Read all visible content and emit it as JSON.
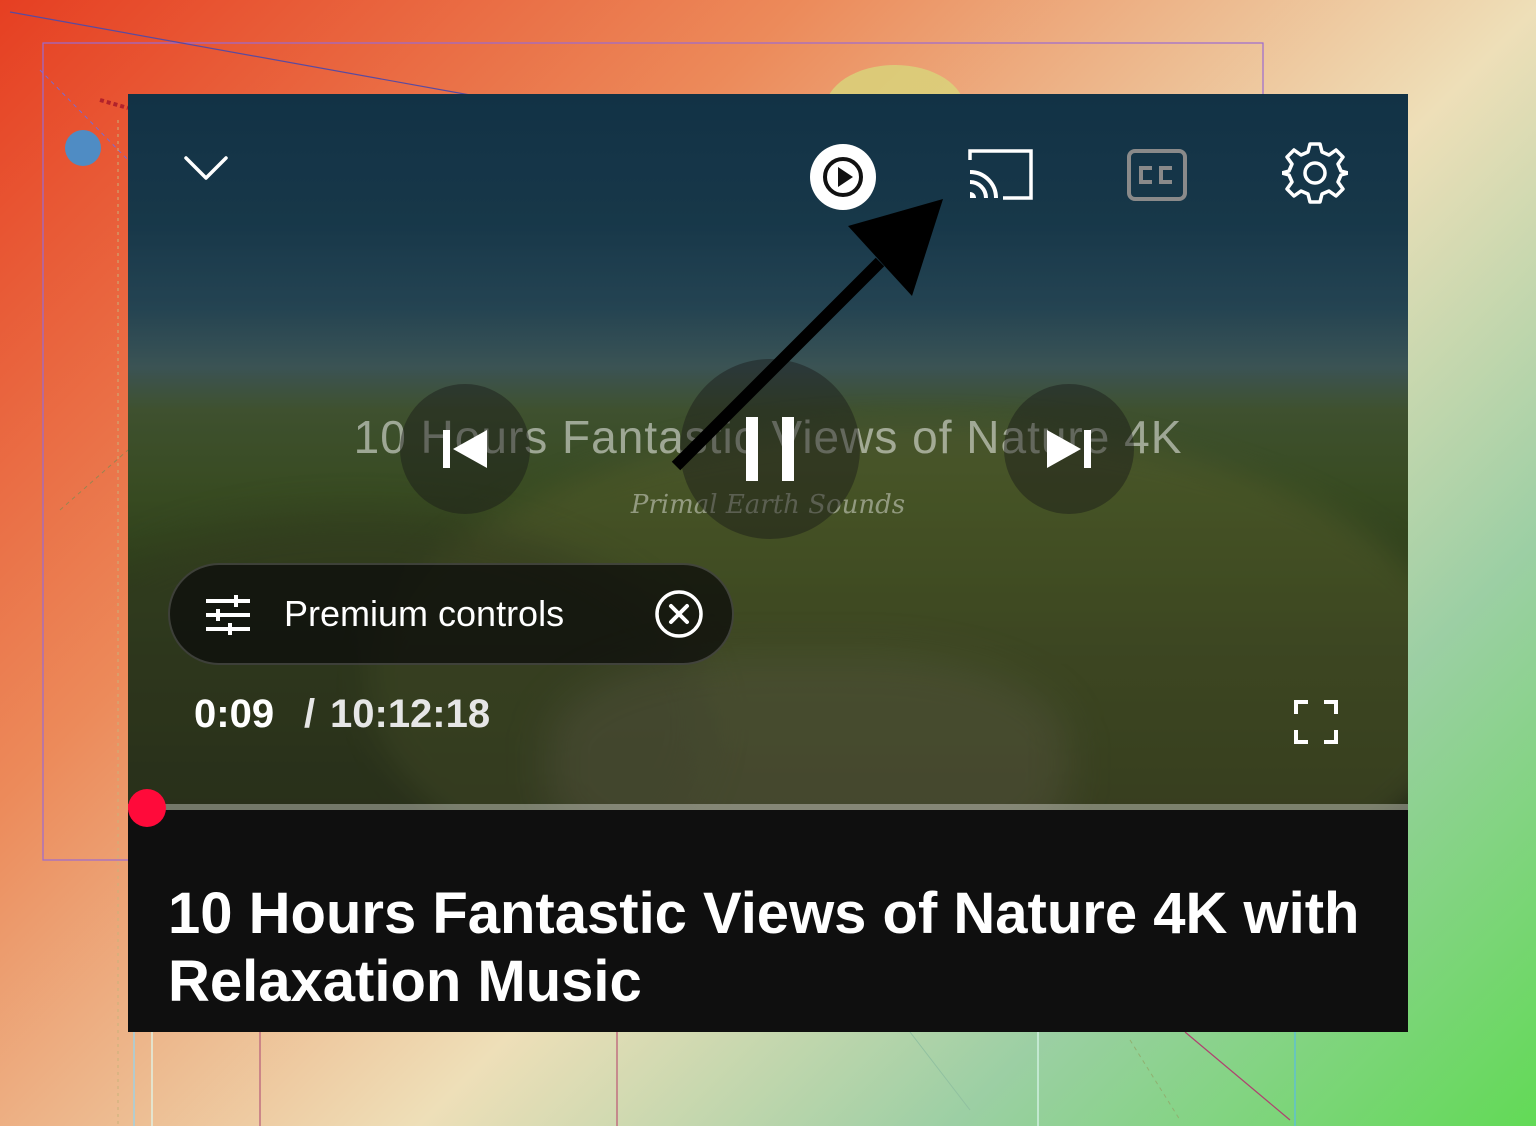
{
  "player": {
    "watermark": {
      "title": "10 Hours Fantastic Views of Nature 4K",
      "brand": "Primal Earth Sounds"
    },
    "top_bar": {
      "minimize_icon": "chevron-down-icon",
      "autoplay_icon": "autoplay-toggle-icon",
      "cast_icon": "cast-icon",
      "captions_icon": "closed-captions-icon",
      "settings_icon": "gear-icon"
    },
    "center_controls": {
      "previous_icon": "skip-previous-icon",
      "play_pause_icon": "pause-icon",
      "next_icon": "skip-next-icon"
    },
    "premium_controls": {
      "label": "Premium controls",
      "icon": "sliders-icon",
      "dismiss_icon": "close-circle-icon"
    },
    "time": {
      "current": "0:09",
      "separator": "/",
      "total": "10:12:18"
    },
    "progress": {
      "fraction": 0.0003
    },
    "fullscreen_icon": "fullscreen-icon"
  },
  "video": {
    "title": "10 Hours Fantastic Views of Nature 4K with Relaxation Music"
  },
  "annotation": {
    "arrow_icon": "pointer-arrow-icon"
  },
  "colors": {
    "progress_red": "#ff0033",
    "panel_dark": "#0f0f0f",
    "captions_disabled": "#8a8a8a"
  }
}
